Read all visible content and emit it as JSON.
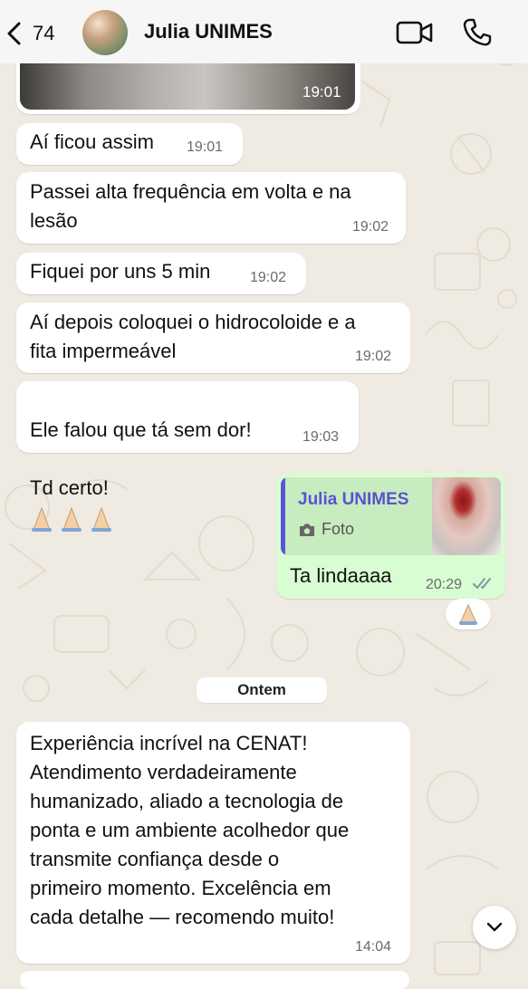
{
  "header": {
    "back_count": "74",
    "contact_name": "Julia UNIMES"
  },
  "messages": [
    {
      "time": "19:01"
    },
    {
      "text": "Aí ficou assim",
      "time": "19:01"
    },
    {
      "text": "Passei alta frequência em volta e na\nlesão",
      "time": "19:02"
    },
    {
      "text": "Fiquei por uns 5 min",
      "time": "19:02"
    },
    {
      "text": "Aí depois coloquei o hidrocoloide e a\nfita impermeável",
      "time": "19:02"
    },
    {
      "text_line1": "Ele falou que tá sem dor!",
      "text_line2": "Td certo!",
      "time": "19:03"
    },
    {
      "quote_name": "Julia UNIMES",
      "quote_type": "Foto",
      "text": "Ta lindaaaa",
      "time": "20:29"
    },
    {
      "text": "Experiência incrível na CENAT!\nAtendimento verdadeiramente\nhumanizado, aliado a tecnologia de\nponta e um ambiente acolhedor que\ntransmite confiança desde o\nprimeiro momento. Excelência em\ncada detalhe — recomendo muito!",
      "time": "14:04"
    }
  ],
  "date_separator": "Ontem",
  "colors": {
    "chat_background": "#efeae2",
    "incoming_bubble": "#ffffff",
    "outgoing_bubble": "#d9fdd3",
    "quote_accent": "#5b52d0",
    "read_ticks": "#8696a0"
  },
  "icons": [
    "back-chevron-icon",
    "video-call-icon",
    "phone-icon",
    "camera-icon",
    "double-check-icon",
    "folded-hands-emoji",
    "chevron-down-icon"
  ]
}
